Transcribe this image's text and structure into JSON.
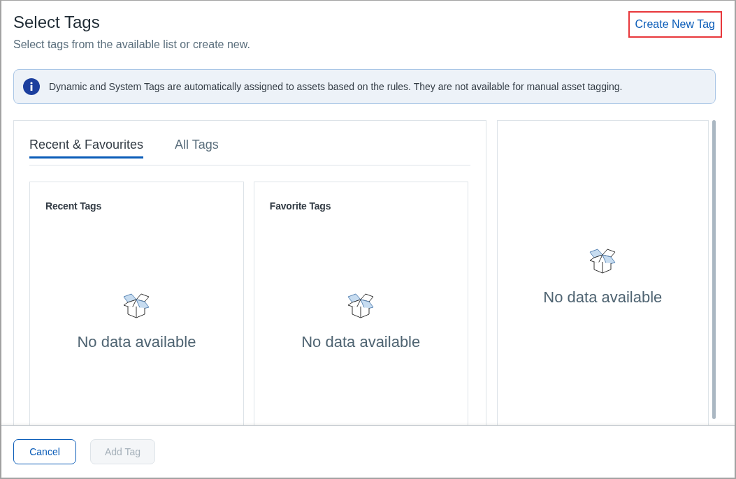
{
  "dialog": {
    "title": "Select Tags",
    "subtitle": "Select tags from the available list or create new.",
    "create_link": {
      "label": "Create New Tag",
      "highlighted": true
    }
  },
  "info_banner": {
    "text": "Dynamic and System Tags are automatically assigned to assets based on the rules. They are not available for manual asset tagging."
  },
  "tabs": [
    {
      "label": "Recent & Favourites",
      "selected": true
    },
    {
      "label": "All Tags",
      "selected": false
    }
  ],
  "tag_cards": [
    {
      "title": "Recent Tags",
      "empty_text": "No data available"
    },
    {
      "title": "Favorite Tags",
      "empty_text": "No data available"
    }
  ],
  "selected_panel": {
    "empty_text": "No data available"
  },
  "buttons": [
    {
      "label": "Cancel",
      "disabled": false
    },
    {
      "label": "Add Tag",
      "disabled": true
    }
  ]
}
